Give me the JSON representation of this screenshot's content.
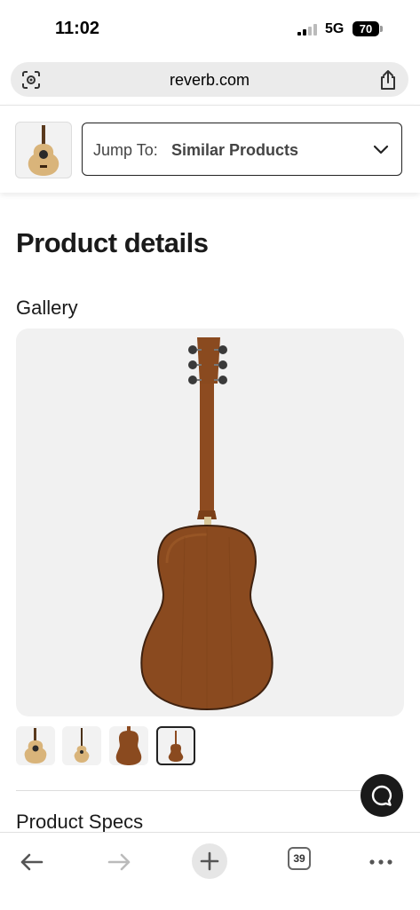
{
  "status_bar": {
    "time": "11:02",
    "network": "5G",
    "battery": "70"
  },
  "browser": {
    "url": "reverb.com",
    "tab_count": "39"
  },
  "jump_to": {
    "label": "Jump To:",
    "value": "Similar Products"
  },
  "page": {
    "title": "Product details",
    "gallery_label": "Gallery",
    "specs_label": "Product Specs"
  },
  "gallery": {
    "selected_index": 3,
    "thumbnails": [
      "front-view",
      "full-front-view",
      "back-body",
      "full-back-view"
    ]
  },
  "colors": {
    "accent": "#1a1a1a",
    "gallery_bg": "#f1f1f1",
    "wood": "#8a4a1f"
  }
}
